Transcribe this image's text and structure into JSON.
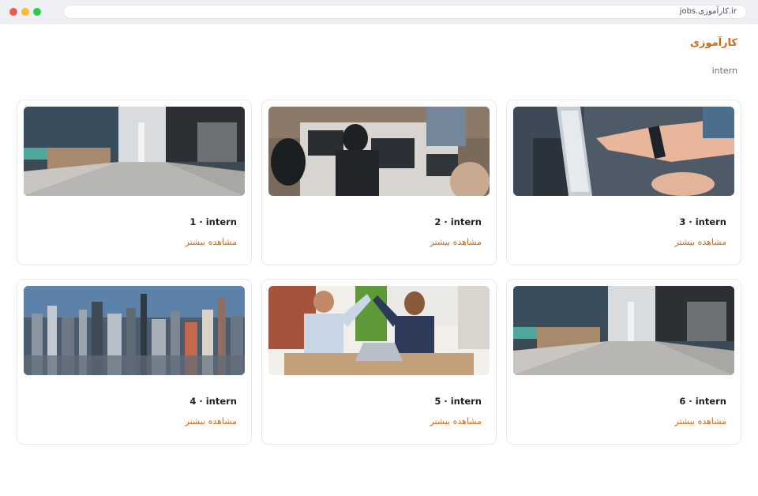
{
  "browser": {
    "url": "jobs.کارآموزی.ir"
  },
  "page": {
    "title": "کارآموزی",
    "subtitle": "intern"
  },
  "cards": [
    {
      "title": "1 · intern",
      "link": "مشاهده بیشتر",
      "image": "office-corridor"
    },
    {
      "title": "2 · intern",
      "link": "مشاهده بیشتر",
      "image": "team-laptops"
    },
    {
      "title": "3 · intern",
      "link": "مشاهده بیشتر",
      "image": "hand-pointing-screen"
    },
    {
      "title": "4 · intern",
      "link": "مشاهده بیشتر",
      "image": "city-skyline"
    },
    {
      "title": "5 · intern",
      "link": "مشاهده بیشتر",
      "image": "colleagues-high-five"
    },
    {
      "title": "6 · intern",
      "link": "مشاهده بیشتر",
      "image": "office-corridor"
    }
  ],
  "colors": {
    "accent": "#c96a1c",
    "text": "#1d2026",
    "muted": "#6b7079",
    "border": "#e6e8ec"
  }
}
